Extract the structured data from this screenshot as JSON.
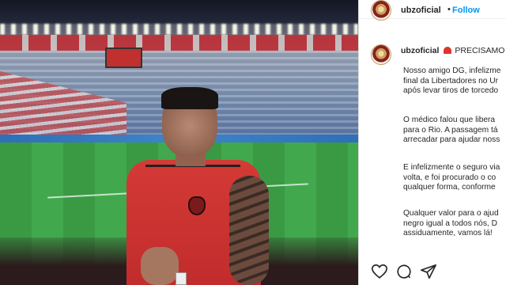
{
  "post": {
    "username": "ubzoficial",
    "follow_label": "Follow",
    "separator": "•",
    "caption_headline": "PRECISAMO",
    "caption_paragraphs": [
      [
        "Nosso amigo DG, infelizme",
        "final da Libertadores no Ur",
        "após levar tiros de torcedo"
      ],
      [
        "O médico falou que libera",
        "para o Rio. A passagem tá",
        "arrecadar para ajudar noss"
      ],
      [
        "E infelizmente o seguro via",
        "volta, e foi procurado o co",
        "qualquer forma, conforme"
      ],
      [
        "Qualquer valor para o ajud",
        "negro igual a todos nós, D",
        "assiduamente, vamos lá!"
      ]
    ]
  },
  "actions": {
    "like": "heart-icon",
    "comment": "comment-icon",
    "share": "share-icon"
  },
  "colors": {
    "accent": "#0095f6",
    "text": "#262626",
    "siren": "#e0342c"
  }
}
